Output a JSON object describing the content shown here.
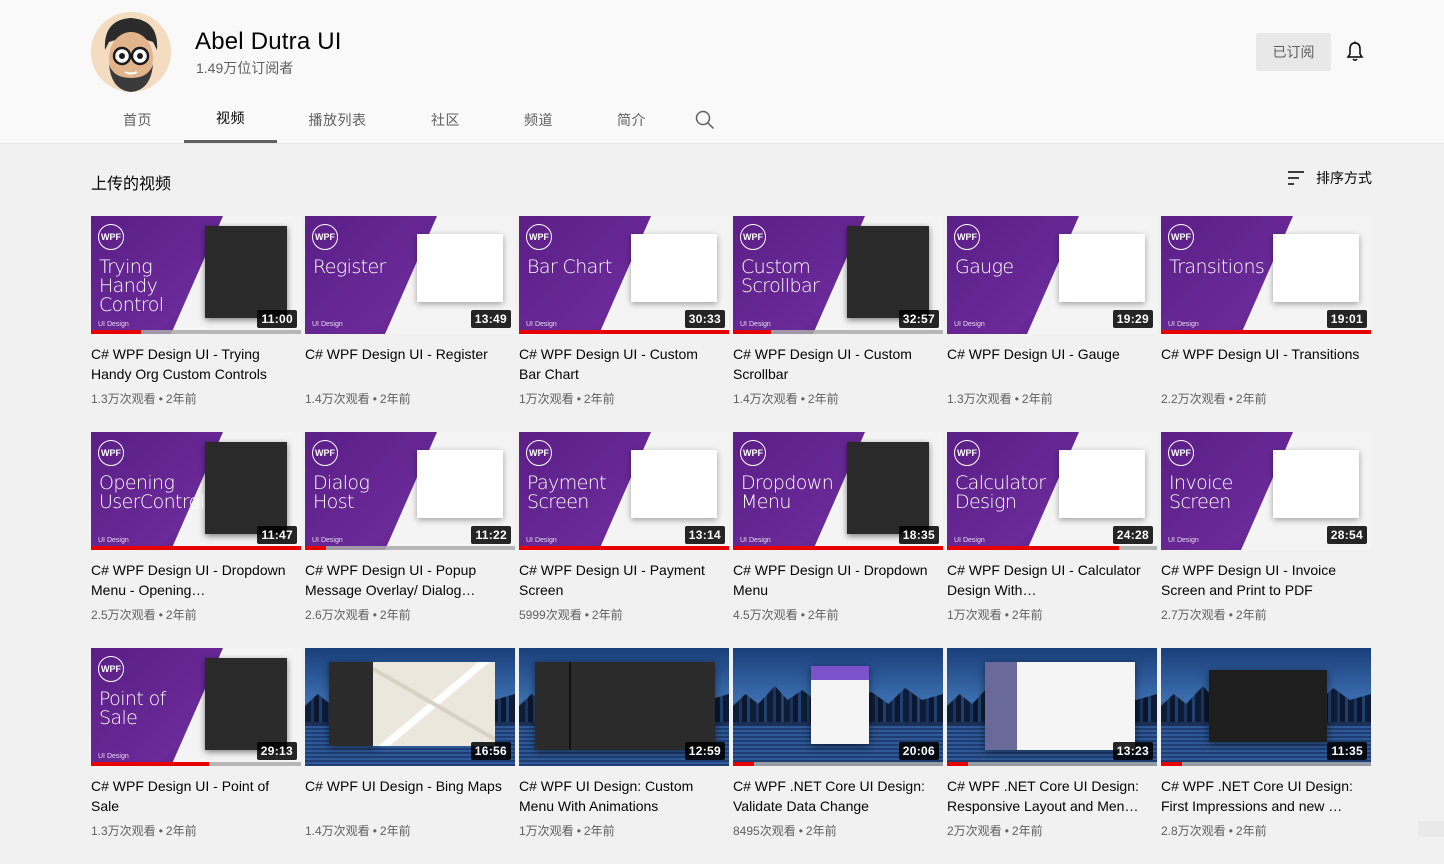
{
  "channel": {
    "name": "Abel Dutra UI",
    "subscribers": "1.49万位订阅者",
    "subscribe_label": "已订阅"
  },
  "tabs": [
    {
      "label": "首页",
      "active": false
    },
    {
      "label": "视频",
      "active": true
    },
    {
      "label": "播放列表",
      "active": false
    },
    {
      "label": "社区",
      "active": false
    },
    {
      "label": "频道",
      "active": false
    },
    {
      "label": "简介",
      "active": false
    }
  ],
  "section": {
    "title": "上传的视频",
    "sort_label": "排序方式"
  },
  "accent_color": "#e60000",
  "videos": [
    {
      "title": "C# WPF Design UI - Trying Handy Org Custom Controls",
      "views": "1.3万次观看",
      "age": "2年前",
      "duration": "11:00",
      "thumb_text": "Trying Handy Control",
      "style": "wpf",
      "progress": 0.24
    },
    {
      "title": "C# WPF Design UI - Register",
      "views": "1.4万次观看",
      "age": "2年前",
      "duration": "13:49",
      "thumb_text": "Register",
      "style": "wpf",
      "progress": 0
    },
    {
      "title": "C# WPF Design UI - Custom Bar Chart",
      "views": "1万次观看",
      "age": "2年前",
      "duration": "30:33",
      "thumb_text": "Bar Chart",
      "style": "wpf",
      "progress": 1.0
    },
    {
      "title": "C# WPF Design UI - Custom Scrollbar",
      "views": "1.4万次观看",
      "age": "2年前",
      "duration": "32:57",
      "thumb_text": "Custom Scrollbar",
      "style": "wpf",
      "progress": 0.18
    },
    {
      "title": "C# WPF Design UI - Gauge",
      "views": "1.3万次观看",
      "age": "2年前",
      "duration": "19:29",
      "thumb_text": "Gauge",
      "style": "wpf",
      "progress": 0
    },
    {
      "title": "C# WPF Design UI - Transitions",
      "views": "2.2万次观看",
      "age": "2年前",
      "duration": "19:01",
      "thumb_text": "Transitions",
      "style": "wpf",
      "progress": 1.0
    },
    {
      "title": "C# WPF Design UI - Dropdown Menu - Opening…",
      "views": "2.5万次观看",
      "age": "2年前",
      "duration": "11:47",
      "thumb_text": "Opening UserControl",
      "style": "wpf",
      "progress": 1.0
    },
    {
      "title": "C# WPF Design UI - Popup Message Overlay/ Dialog…",
      "views": "2.6万次观看",
      "age": "2年前",
      "duration": "11:22",
      "thumb_text": "Dialog Host",
      "style": "wpf",
      "progress": 0.1
    },
    {
      "title": "C# WPF Design UI - Payment Screen",
      "views": "5999次观看",
      "age": "2年前",
      "duration": "13:14",
      "thumb_text": "Payment Screen",
      "style": "wpf",
      "progress": 1.0
    },
    {
      "title": "C# WPF Design UI - Dropdown Menu",
      "views": "4.5万次观看",
      "age": "2年前",
      "duration": "18:35",
      "thumb_text": "Dropdown Menu",
      "style": "wpf",
      "progress": 1.0
    },
    {
      "title": "C# WPF Design UI - Calculator Design With…",
      "views": "1万次观看",
      "age": "2年前",
      "duration": "24:28",
      "thumb_text": "Calculator Design",
      "style": "wpf",
      "progress": 0.82
    },
    {
      "title": "C# WPF Design UI - Invoice Screen and Print to PDF",
      "views": "2.7万次观看",
      "age": "2年前",
      "duration": "28:54",
      "thumb_text": "Invoice Screen",
      "style": "wpf",
      "progress": 0
    },
    {
      "title": "C# WPF Design UI - Point of Sale",
      "views": "1.3万次观看",
      "age": "2年前",
      "duration": "29:13",
      "thumb_text": "Point of Sale",
      "style": "wpf",
      "progress": 0.56
    },
    {
      "title": "C# WPF UI Design - Bing Maps",
      "views": "1.4万次观看",
      "age": "2年前",
      "duration": "16:56",
      "thumb_text": "",
      "style": "map",
      "progress": 0
    },
    {
      "title": "C# WPF UI Design: Custom Menu With Animations",
      "views": "1万次观看",
      "age": "2年前",
      "duration": "12:59",
      "thumb_text": "",
      "style": "dark",
      "progress": 0
    },
    {
      "title": "C# WPF .NET Core UI Design: Validate Data Change",
      "views": "8495次观看",
      "age": "2年前",
      "duration": "20:06",
      "thumb_text": "",
      "style": "form",
      "progress": 0.1
    },
    {
      "title": "C# WPF .NET Core UI Design: Responsive Layout and Men…",
      "views": "2万次观看",
      "age": "2年前",
      "duration": "13:23",
      "thumb_text": "",
      "style": "light",
      "progress": 0.1
    },
    {
      "title": "C# WPF .NET Core UI Design: First Impressions and new …",
      "views": "2.8万次观看",
      "age": "2年前",
      "duration": "11:35",
      "thumb_text": "",
      "style": "vs",
      "progress": 0.1
    }
  ],
  "thumb_labels": {
    "badge": "WPF",
    "brand": "UI Design"
  }
}
